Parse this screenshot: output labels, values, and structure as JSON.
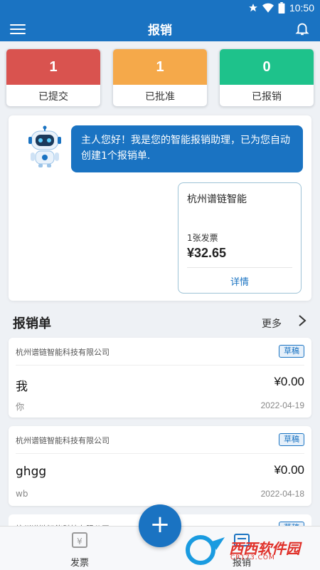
{
  "status_bar": {
    "time": "10:50"
  },
  "app_bar": {
    "title": "报销"
  },
  "stats": [
    {
      "count": "1",
      "label": "已提交",
      "color": "#d9534f"
    },
    {
      "count": "1",
      "label": "已批准",
      "color": "#f5a94a"
    },
    {
      "count": "0",
      "label": "已报销",
      "color": "#1ec28b"
    }
  ],
  "assistant": {
    "message": "主人您好！我是您的智能报销助理，已为您自动创建1个报销单.",
    "receipt": {
      "company": "杭州谱链智能",
      "invoice_count": "1张发票",
      "amount": "¥32.65",
      "detail_label": "详情"
    }
  },
  "section": {
    "title": "报销单",
    "more_label": "更多"
  },
  "claims": [
    {
      "company": "杭州谱链智能科技有限公司",
      "status": "草稿",
      "name": "我",
      "amount": "¥0.00",
      "submitter": "你",
      "date": "2022-04-19"
    },
    {
      "company": "杭州谱链智能科技有限公司",
      "status": "草稿",
      "name": "ghgg",
      "amount": "¥0.00",
      "submitter": "wb",
      "date": "2022-04-18"
    },
    {
      "company": "杭州谱链智能科技有限公司",
      "status": "草稿"
    }
  ],
  "bottom_nav": {
    "tabs": [
      {
        "label": "发票"
      },
      {
        "label": "报销"
      }
    ],
    "fab_symbol": "+"
  },
  "watermark": {
    "text": "西西软件园",
    "sub": "CR173.COM"
  },
  "colors": {
    "primary": "#1a73c2"
  }
}
